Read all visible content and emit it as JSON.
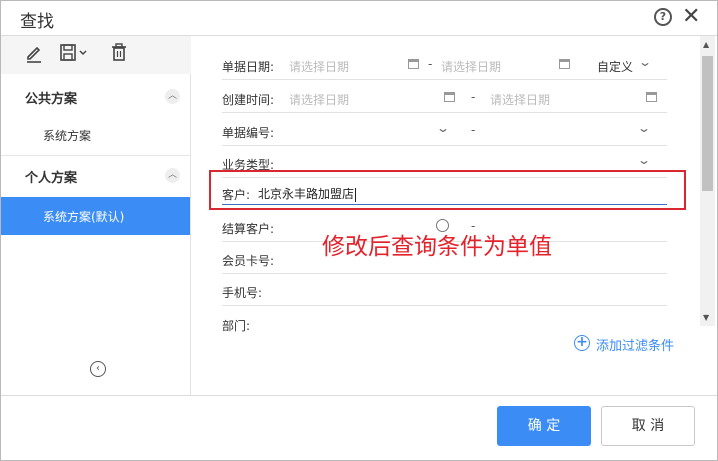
{
  "window": {
    "title": "查找"
  },
  "sidebar": {
    "public_title": "公共方案",
    "public_items": [
      "系统方案"
    ],
    "personal_title": "个人方案",
    "personal_items": [
      "系统方案(默认)"
    ]
  },
  "filters": {
    "doc_date": {
      "label": "单据日期:",
      "start_placeholder": "请选择日期",
      "sep": "-",
      "end_placeholder": "请选择日期",
      "range_mode": "自定义"
    },
    "create_time": {
      "label": "创建时间:",
      "start_placeholder": "请选择日期",
      "sep": "-",
      "end_placeholder": "请选择日期"
    },
    "doc_no": {
      "label": "单据编号:",
      "sep": "-"
    },
    "biz_type": {
      "label": "业务类型:"
    },
    "customer": {
      "label": "客户:",
      "value": "北京永丰路加盟店"
    },
    "settle_customer": {
      "label": "结算客户:",
      "sep": "-"
    },
    "member_card": {
      "label": "会员卡号:"
    },
    "phone": {
      "label": "手机号:"
    },
    "department": {
      "label": "部门:"
    },
    "add_filter_label": "添加过滤条件"
  },
  "annotation": "修改后查询条件为单值",
  "footer": {
    "ok_label": "确 定",
    "cancel_label": "取 消"
  },
  "colors": {
    "accent": "#3b8cf5",
    "highlight": "#d9262f"
  }
}
